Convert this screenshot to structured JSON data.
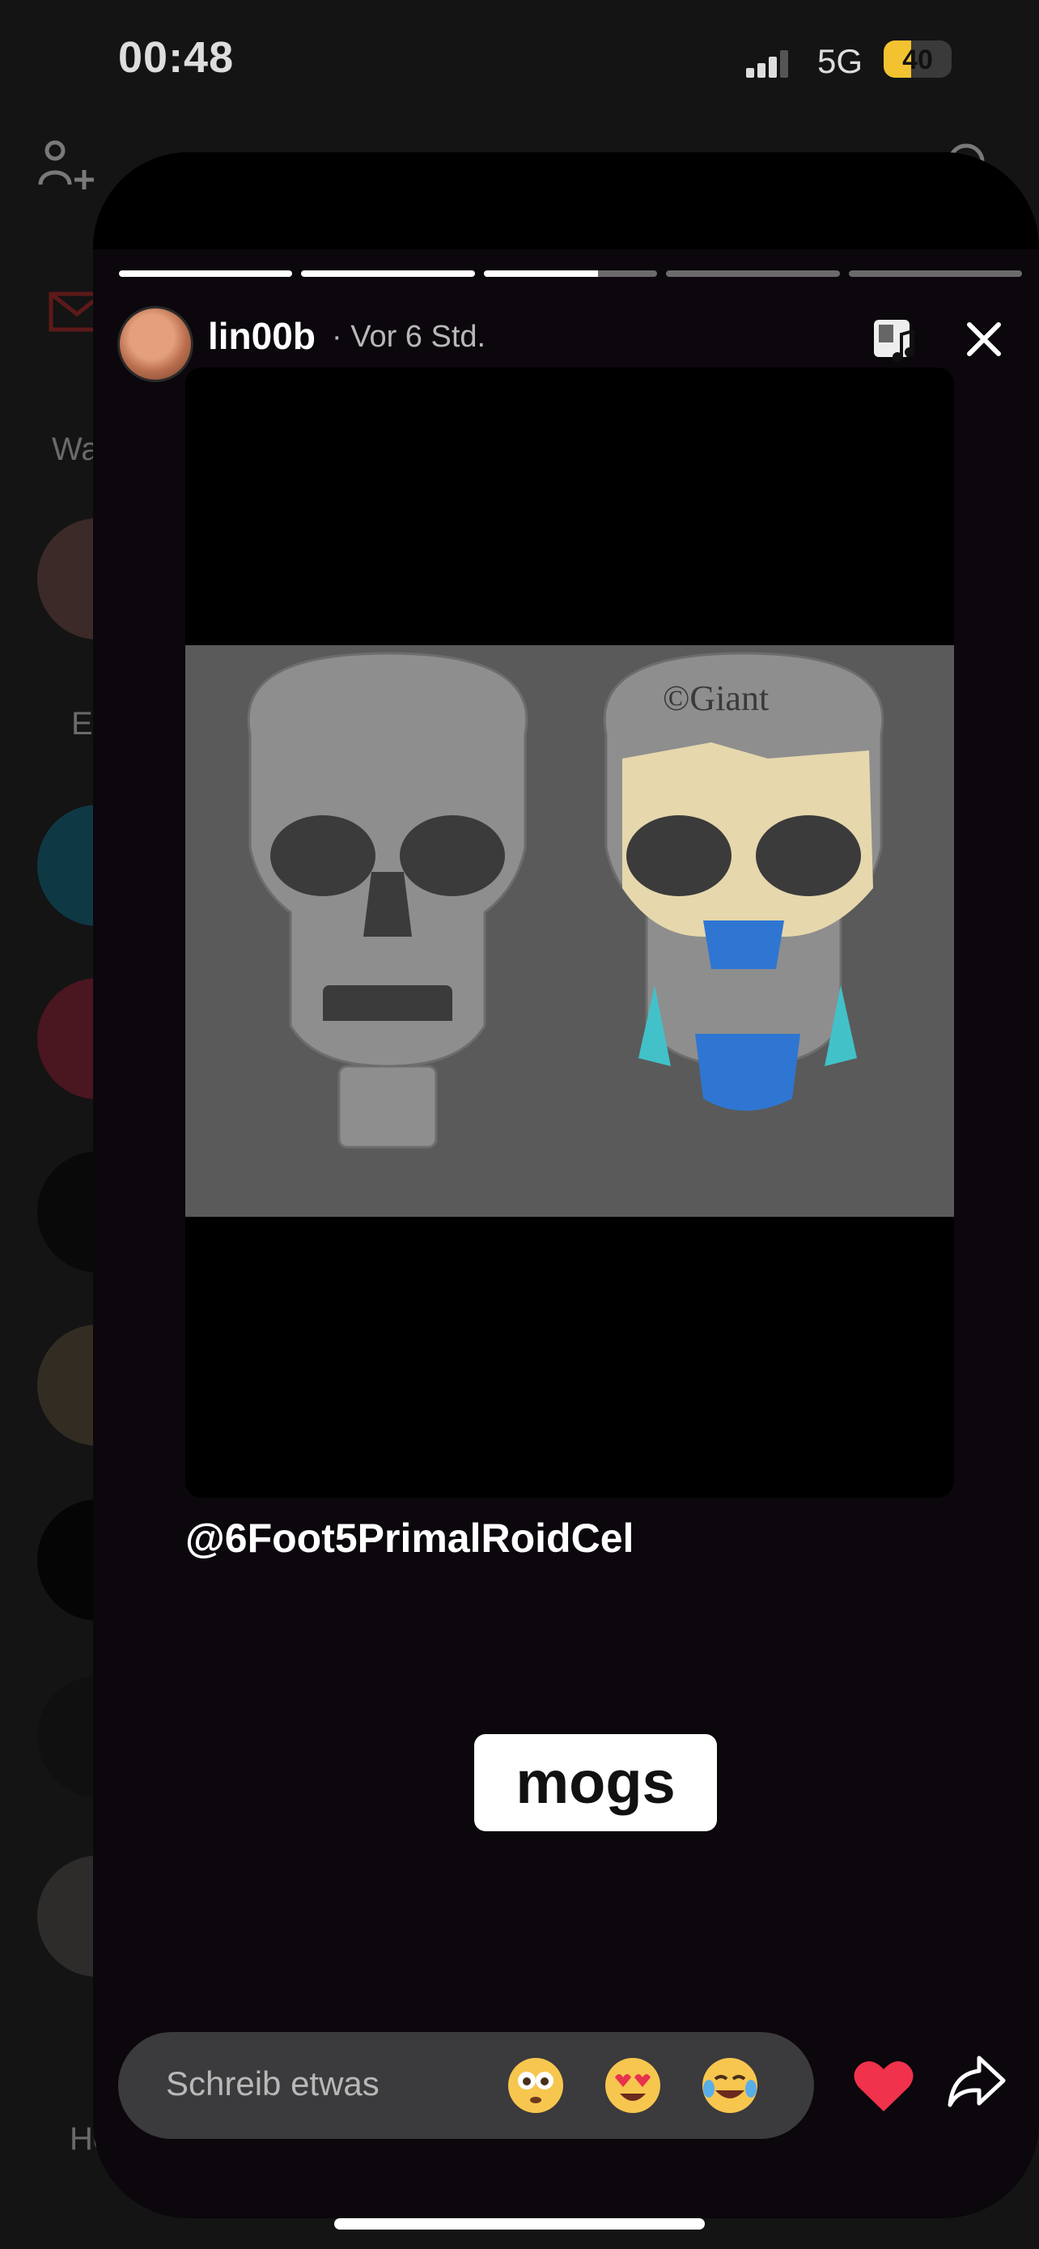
{
  "status_bar": {
    "time": "00:48",
    "network": "5G",
    "battery": "40",
    "battery_level": 0.4
  },
  "behind": {
    "left_text_1": "Wa",
    "left_text_2": "Er",
    "left_text_3": "Ho"
  },
  "story": {
    "username": "lin00b",
    "time": "· Vor 6 Std.",
    "image_watermark": "©Giant",
    "mention": "@6Foot5PrimalRoidCel",
    "sticker": "mogs",
    "progress": [
      1,
      1,
      0.66,
      0,
      0
    ]
  },
  "reply": {
    "placeholder": "Schreib etwas",
    "emojis": [
      "flushed",
      "heart-eyes",
      "tears-of-joy"
    ]
  },
  "colors": {
    "accent_heart": "#f0324c",
    "background": "#0b070c",
    "pill": "#3b3a3c"
  }
}
